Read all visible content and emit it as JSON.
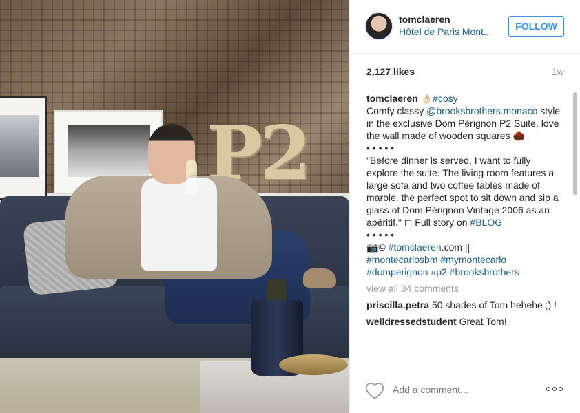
{
  "post": {
    "photo_alt": "",
    "wall_letters": "P2"
  },
  "header": {
    "username": "tomclaeren",
    "location": "Hôtel de Paris Mont...",
    "follow_label": "FOLLOW"
  },
  "stats": {
    "likes": "2,127 likes",
    "time": "1w"
  },
  "caption": {
    "author": "tomclaeren",
    "emoji_ok": "👌🏻",
    "tag_cosy": "#cosy",
    "line1_pre": "Comfy classy ",
    "mention": "@brooksbrothers.monaco",
    "line1_post": " style in the exclusive Dom Pérignon P2 Suite, love the wall made of wooden squares 🌰",
    "dots1": "• • • • •",
    "quote_pre": "\"Before dinner is served, I want to fully explore the suite. The living room features a large sofa and two coffee tables made of marble, the perfect spot to sit down and sip a glass of Dom Pérignon Vintage 2006 as an apéritif.\" ◻ Full story on ",
    "tag_blog": "#BLOG",
    "dots2": "• • • • •",
    "camera": "📷© ",
    "tag_site": "#tomclaeren",
    "site_rest": ".com ||",
    "tags": [
      "#montecarlosbm",
      "#mymontecarlo",
      "#domperignon",
      "#p2",
      "#brooksbrothers"
    ]
  },
  "view_all": "view all 34 comments",
  "comments": [
    {
      "user": "priscilla.petra",
      "text": "50 shades of Tom hehehe ;) !"
    },
    {
      "user": "welldressedstudent",
      "text": "Great Tom!"
    }
  ],
  "footer": {
    "add_comment_placeholder": "Add a comment..."
  },
  "colors": {
    "link": "#1a5f8a",
    "follow": "#3897f0",
    "muted": "#999999"
  },
  "icons": {
    "like": "heart-icon",
    "more": "more-options-icon"
  }
}
